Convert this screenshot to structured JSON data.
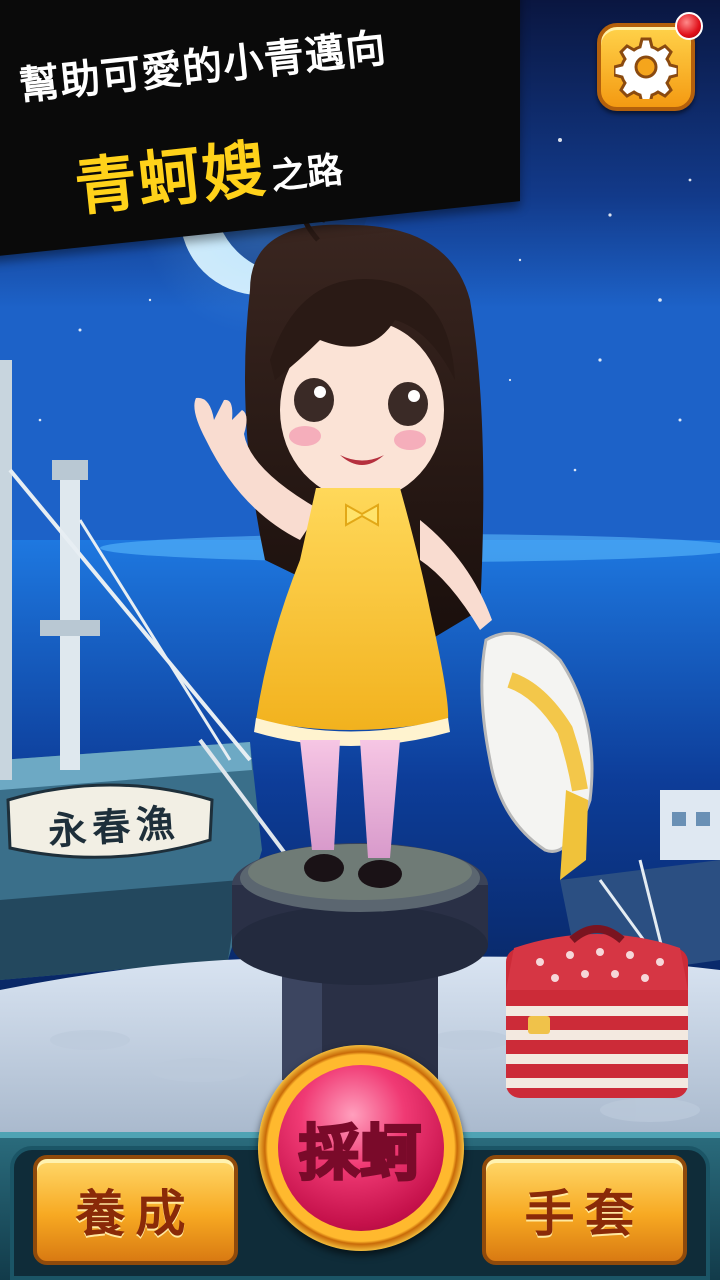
{
  "banner": {
    "line1": "幫助可愛的小青邁向",
    "highlight": "青蚵嫂",
    "suffix": "之路"
  },
  "settings": {
    "icon": "gear-icon",
    "has_notification": true
  },
  "boat": {
    "name_sign": "永春漁"
  },
  "bottom_nav": {
    "left_label": "養成",
    "center_label": "採蚵",
    "right_label": "手套"
  },
  "colors": {
    "banner_highlight": "#ffd21a",
    "banner_bg": "#0a0a0a",
    "button_orange": "#f7a922",
    "center_pink": "#f03a74",
    "notification_red": "#e0101a"
  }
}
